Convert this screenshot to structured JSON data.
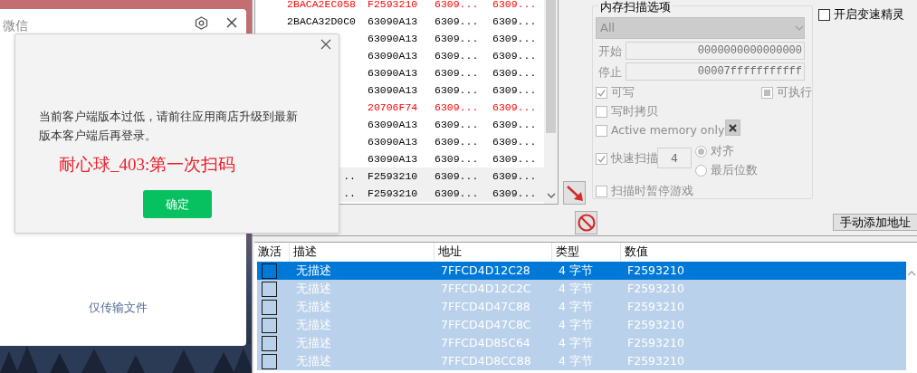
{
  "wechat_window": {
    "title": "微信",
    "link": "仅传输文件"
  },
  "dialog": {
    "message": "当前客户端版本过低，请前往应用商店升级到最新版本客户端后再登录。",
    "note": "耐心球_403:第一次扫码",
    "button": "确定"
  },
  "scan_results": {
    "rows": [
      {
        "column_1": "2BACA2EC058",
        "column_2": "F2593210",
        "column_3": "6309...",
        "column_4": "6309...",
        "changed": true,
        "highlighted": false
      },
      {
        "column_1": "2BACA32D0C0",
        "column_2": "63090A13",
        "column_3": "6309...",
        "column_4": "6309...",
        "changed": false,
        "highlighted": false
      },
      {
        "column_2": "63090A13",
        "column_3": "6309...",
        "column_4": "6309...",
        "changed": false,
        "highlighted": false
      },
      {
        "column_2": "63090A13",
        "column_3": "6309...",
        "column_4": "6309...",
        "changed": false,
        "highlighted": false
      },
      {
        "column_2": "63090A13",
        "column_3": "6309...",
        "column_4": "6309...",
        "changed": false,
        "highlighted": false
      },
      {
        "column_2": "63090A13",
        "column_3": "6309...",
        "column_4": "6309...",
        "changed": false,
        "highlighted": false
      },
      {
        "column_2": "20706F74",
        "column_3": "6309...",
        "column_4": "6309...",
        "changed": true,
        "highlighted": false
      },
      {
        "column_2": "63090A13",
        "column_3": "6309...",
        "column_4": "6309...",
        "changed": false,
        "highlighted": false
      },
      {
        "column_2": "63090A13",
        "column_3": "6309...",
        "column_4": "6309...",
        "changed": false,
        "highlighted": false
      },
      {
        "column_2": "63090A13",
        "column_3": "6309...",
        "column_4": "6309...",
        "changed": false,
        "highlighted": false
      },
      {
        "column_1": "..",
        "column_2": "F2593210",
        "column_3": "6309...",
        "column_4": "6309...",
        "changed": false,
        "highlighted": true
      },
      {
        "column_1": "..",
        "column_2": "F2593210",
        "column_3": "6309...",
        "column_4": "6309...",
        "changed": false,
        "highlighted": true
      }
    ]
  },
  "memory_scan_options": {
    "title": "内存扫描选项",
    "disabled": true,
    "region": "All",
    "start_label": "开始",
    "start": "0000000000000000",
    "stop_label": "停止",
    "stop": "00007fffffffffff",
    "writable": {
      "label": "可写",
      "checked": true
    },
    "executable": {
      "label": "可执行",
      "indeterminate": true
    },
    "copy_on_write": {
      "label": "写时拷贝",
      "checked": false
    },
    "active_memory_only": {
      "label": "Active memory only",
      "checked": false
    },
    "fast_scan": {
      "label": "快速扫描",
      "checked": true,
      "value": "4"
    },
    "alignment": [
      {
        "label": "对齐",
        "selected": true
      },
      {
        "label": "最后位数",
        "selected": false
      }
    ],
    "pause_game": {
      "label": "扫描时暂停游戏",
      "checked": false
    }
  },
  "speedhack": {
    "label": "开启变速精灵",
    "checked": false
  },
  "add_address_button": "手动添加地址",
  "address_list": {
    "columns": [
      "激活",
      "描述",
      "地址",
      "类型",
      "数值"
    ],
    "rows": [
      {
        "active": false,
        "description": "无描述",
        "address": "7FFCD4D12C28",
        "type": "4 字节",
        "value": "F2593210",
        "selected": true
      },
      {
        "active": false,
        "description": "无描述",
        "address": "7FFCD4D12C2C",
        "type": "4 字节",
        "value": "F2593210",
        "selected": false
      },
      {
        "active": false,
        "description": "无描述",
        "address": "7FFCD4D47C88",
        "type": "4 字节",
        "value": "F2593210",
        "selected": false
      },
      {
        "active": false,
        "description": "无描述",
        "address": "7FFCD4D47C8C",
        "type": "4 字节",
        "value": "F2593210",
        "selected": false
      },
      {
        "active": false,
        "description": "无描述",
        "address": "7FFCD4D85C64",
        "type": "4 字节",
        "value": "F2593210",
        "selected": false
      },
      {
        "active": false,
        "description": "无描述",
        "address": "7FFCD4D8CC88",
        "type": "4 字节",
        "value": "F2593210",
        "selected": false
      }
    ]
  }
}
